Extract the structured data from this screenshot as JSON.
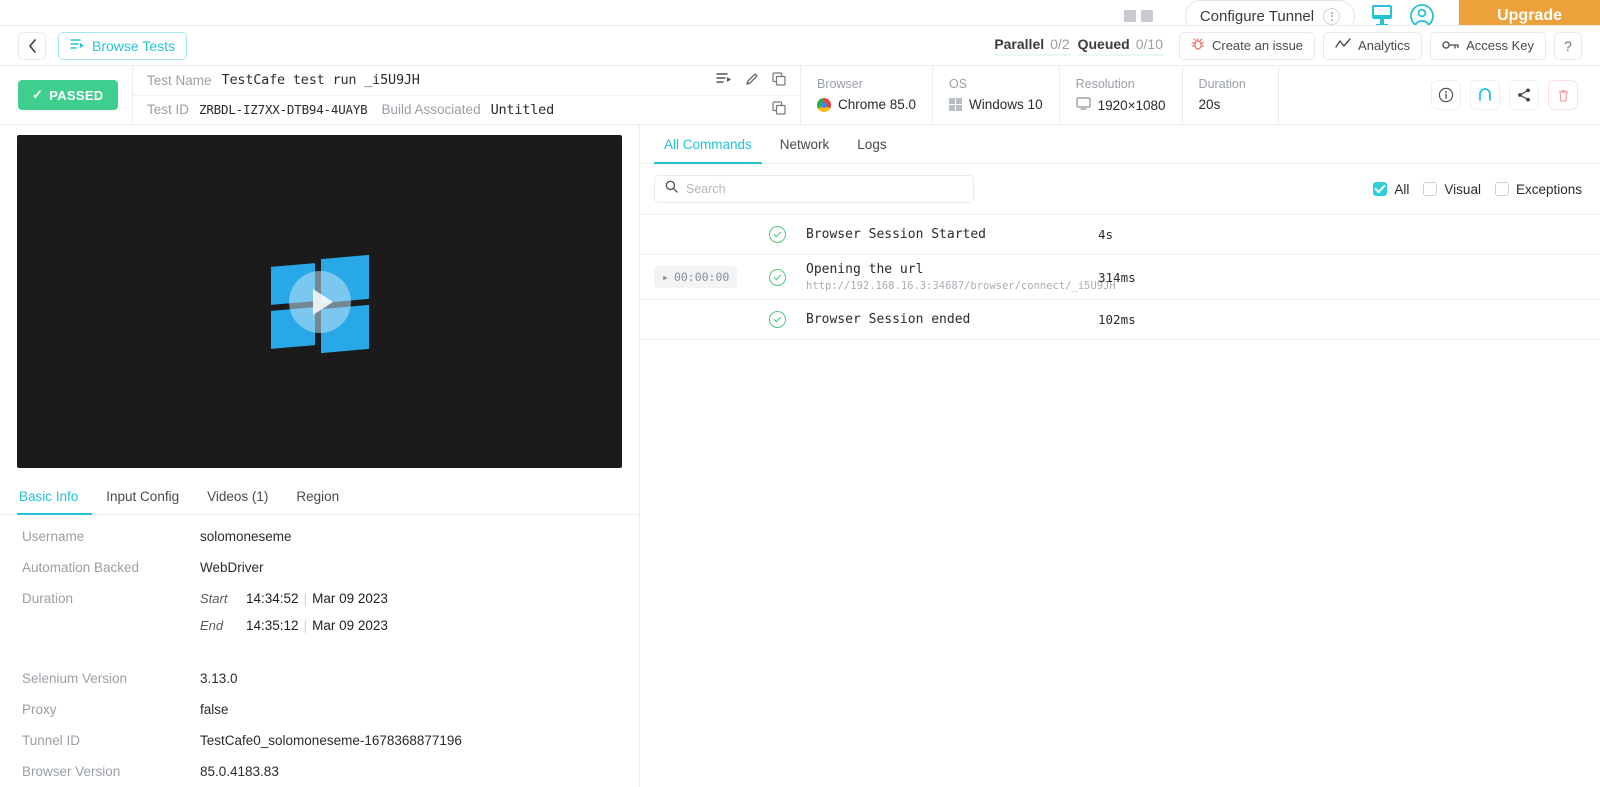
{
  "topbar": {
    "configure_tunnel": "Configure Tunnel",
    "upgrade": "Upgrade"
  },
  "nav": {
    "browse_tests": "Browse Tests",
    "parallel_label": "Parallel",
    "parallel_value": "0/2",
    "queued_label": "Queued",
    "queued_value": "0/10",
    "create_issue": "Create an issue",
    "analytics": "Analytics",
    "access_key": "Access Key",
    "help": "?"
  },
  "test": {
    "status": "PASSED",
    "name_label": "Test Name",
    "name_value": "TestCafe test run _i5U9JH",
    "id_label": "Test ID",
    "id_value": "ZRBDL-IZ7XX-DTB94-4UAYB",
    "build_label": "Build Associated",
    "build_value": "Untitled"
  },
  "specs": [
    {
      "key": "Browser",
      "value": "Chrome 85.0",
      "icon": "chrome-icon"
    },
    {
      "key": "OS",
      "value": "Windows 10",
      "icon": "windows-icon"
    },
    {
      "key": "Resolution",
      "value": "1920×1080",
      "icon": "monitor-icon"
    },
    {
      "key": "Duration",
      "value": "20s",
      "icon": ""
    }
  ],
  "left_tabs": [
    {
      "label": "Basic Info",
      "active": true
    },
    {
      "label": "Input Config",
      "active": false
    },
    {
      "label": "Videos (1)",
      "active": false
    },
    {
      "label": "Region",
      "active": false
    }
  ],
  "basic_info": {
    "username_label": "Username",
    "username_value": "solomoneseme",
    "automation_label": "Automation Backed",
    "automation_value": "WebDriver",
    "duration_label": "Duration",
    "start_label": "Start",
    "start_value": "14:34:52",
    "start_date": "Mar 09 2023",
    "end_label": "End",
    "end_value": "14:35:12",
    "end_date": "Mar 09 2023",
    "selenium_label": "Selenium Version",
    "selenium_value": "3.13.0",
    "proxy_label": "Proxy",
    "proxy_value": "false",
    "tunnel_label": "Tunnel ID",
    "tunnel_value": "TestCafe0_solomoneseme-1678368877196",
    "browser_version_label": "Browser Version",
    "browser_version_value": "85.0.4183.83"
  },
  "right_tabs": [
    {
      "label": "All Commands",
      "active": true
    },
    {
      "label": "Network",
      "active": false
    },
    {
      "label": "Logs",
      "active": false
    }
  ],
  "search": {
    "placeholder": "Search",
    "value": ""
  },
  "filters": [
    {
      "label": "All",
      "checked": true
    },
    {
      "label": "Visual",
      "checked": false
    },
    {
      "label": "Exceptions",
      "checked": false
    }
  ],
  "commands": [
    {
      "timestamp": "",
      "name": "Browser Session Started",
      "sub": "",
      "duration": "4s"
    },
    {
      "timestamp": "00:00:00",
      "name": "Opening the url",
      "sub": "http://192.168.16.3:34687/browser/connect/_i5U9JH",
      "duration": "314ms"
    },
    {
      "timestamp": "",
      "name": "Browser Session ended",
      "sub": "",
      "duration": "102ms"
    }
  ],
  "colors": {
    "accent": "#22c3d6",
    "pass_green": "#3ecf8e",
    "upgrade_orange": "#eda13a",
    "bug_red": "#f0756b"
  }
}
